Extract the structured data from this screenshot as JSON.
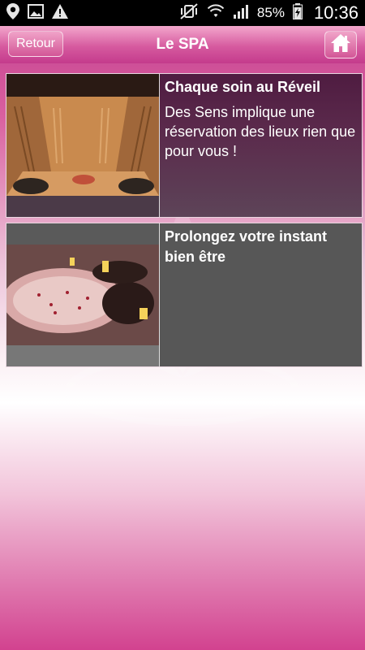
{
  "status_bar": {
    "battery": "85%",
    "time": "10:36"
  },
  "header": {
    "back_label": "Retour",
    "title": "Le SPA"
  },
  "items": [
    {
      "title": "Chaque soin au Réveil",
      "description": "Des Sens implique une réservation des lieux rien que pour vous !"
    },
    {
      "title": "Prolongez votre instant bien être",
      "description": ""
    }
  ]
}
